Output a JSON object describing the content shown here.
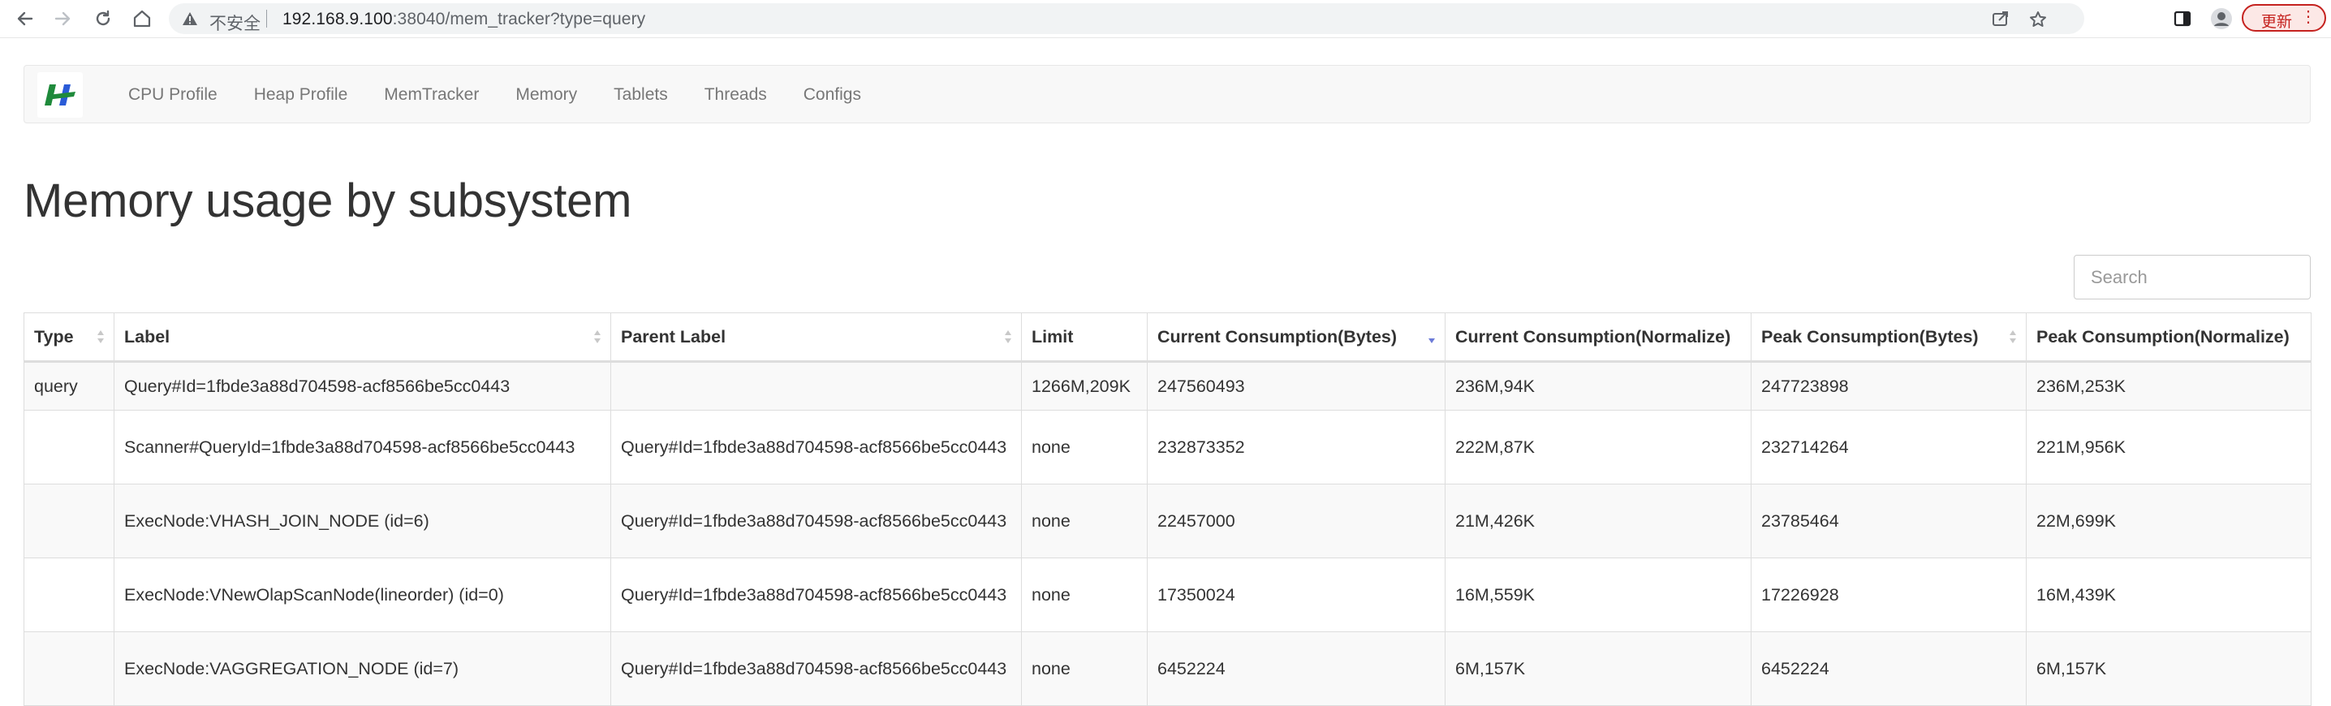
{
  "browser": {
    "insecure_label": "不安全",
    "url_host": "192.168.9.100",
    "url_rest": ":38040/mem_tracker?type=query",
    "update_label": "更新"
  },
  "nav": {
    "brand": "logo",
    "items": [
      "CPU Profile",
      "Heap Profile",
      "MemTracker",
      "Memory",
      "Tablets",
      "Threads",
      "Configs"
    ]
  },
  "page": {
    "title": "Memory usage by subsystem",
    "search_placeholder": "Search"
  },
  "table": {
    "headers": [
      "Type",
      "Label",
      "Parent Label",
      "Limit",
      "Current Consumption(Bytes)",
      "Current Consumption(Normalize)",
      "Peak Consumption(Bytes)",
      "Peak Consumption(Normalize)"
    ],
    "sorted_column": "Current Consumption(Bytes)",
    "sort_direction": "desc",
    "rows": [
      [
        "query",
        "Query#Id=1fbde3a88d704598-acf8566be5cc0443",
        "",
        "1266M,209K",
        "247560493",
        "236M,94K",
        "247723898",
        "236M,253K"
      ],
      [
        "",
        "Scanner#QueryId=1fbde3a88d704598-acf8566be5cc0443",
        "Query#Id=1fbde3a88d704598-acf8566be5cc0443",
        "none",
        "232873352",
        "222M,87K",
        "232714264",
        "221M,956K"
      ],
      [
        "",
        "ExecNode:VHASH_JOIN_NODE (id=6)",
        "Query#Id=1fbde3a88d704598-acf8566be5cc0443",
        "none",
        "22457000",
        "21M,426K",
        "23785464",
        "22M,699K"
      ],
      [
        "",
        "ExecNode:VNewOlapScanNode(lineorder) (id=0)",
        "Query#Id=1fbde3a88d704598-acf8566be5cc0443",
        "none",
        "17350024",
        "16M,559K",
        "17226928",
        "16M,439K"
      ],
      [
        "",
        "ExecNode:VAGGREGATION_NODE (id=7)",
        "Query#Id=1fbde3a88d704598-acf8566be5cc0443",
        "none",
        "6452224",
        "6M,157K",
        "6452224",
        "6M,157K"
      ]
    ]
  },
  "colors": {
    "sort_active": "#6c7bd8",
    "update_red": "#c5221f"
  }
}
